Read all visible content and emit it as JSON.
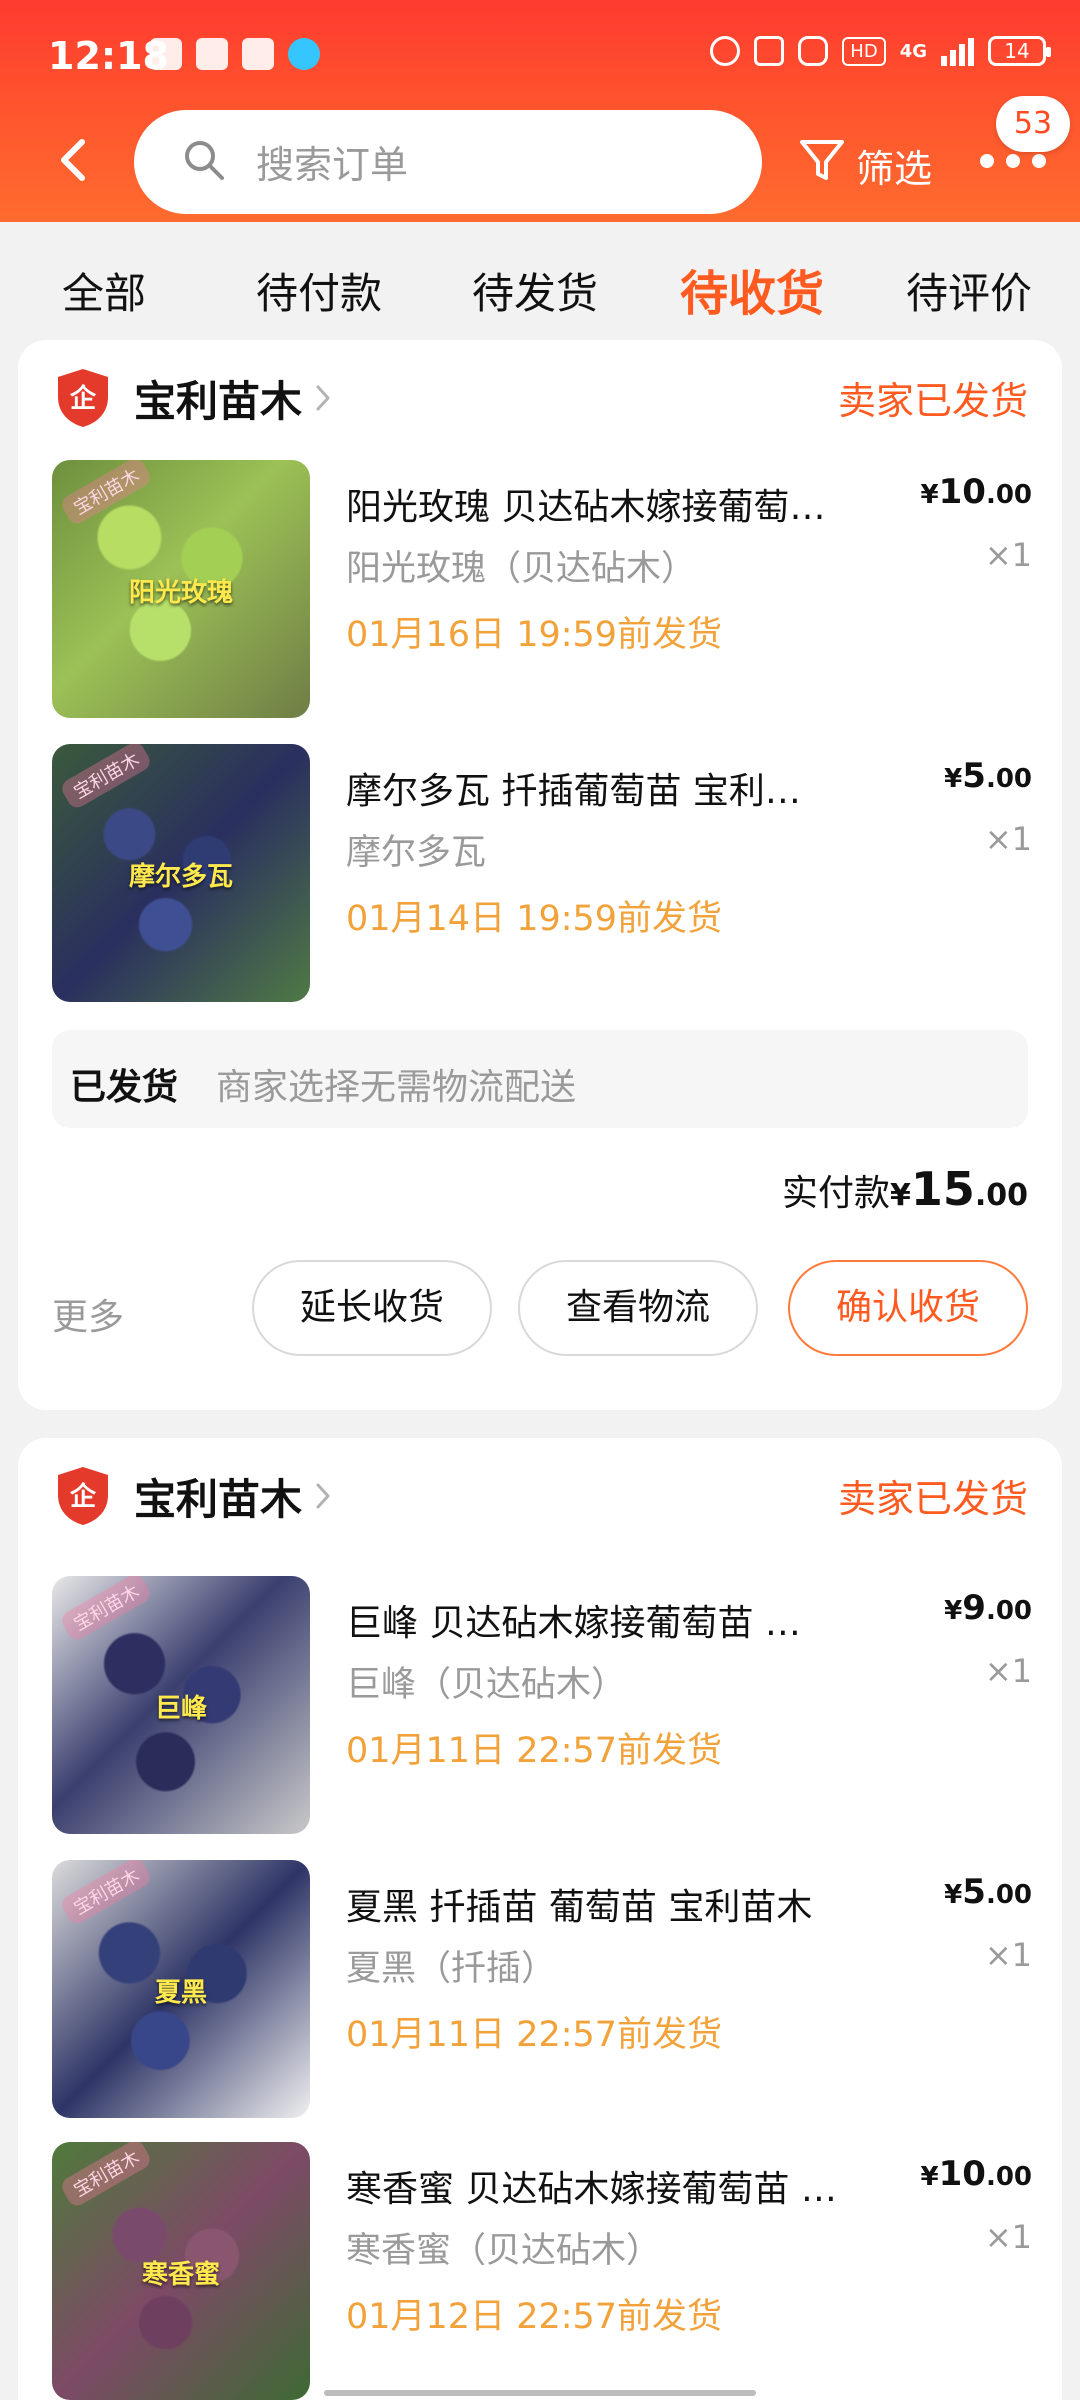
{
  "status_bar": {
    "time": "12:18",
    "network": "4G",
    "battery": "14"
  },
  "topbar": {
    "search_placeholder": "搜索订单",
    "filter_label": "筛选",
    "message_badge": "53"
  },
  "tabs": [
    {
      "label": "全部",
      "active": false
    },
    {
      "label": "待付款",
      "active": false
    },
    {
      "label": "待发货",
      "active": false
    },
    {
      "label": "待收货",
      "active": true
    },
    {
      "label": "待评价",
      "active": false
    }
  ],
  "orders": [
    {
      "store_name": "宝利苗木",
      "status": "卖家已发货",
      "items": [
        {
          "title": "阳光玫瑰  贝达砧木嫁接葡萄…",
          "spec": "阳光玫瑰（贝达砧木）",
          "ship": "01月16日  19:59前发货",
          "price_symbol": "¥",
          "price_int": "10",
          "price_dec": ".00",
          "qty": "×1",
          "thumb_label": "阳光玫瑰",
          "thumb_tag": "宝利苗木"
        },
        {
          "title": "摩尔多瓦    扦插葡萄苗    宝利…",
          "spec": "摩尔多瓦",
          "ship": "01月14日  19:59前发货",
          "price_symbol": "¥",
          "price_int": "5",
          "price_dec": ".00",
          "qty": "×1",
          "thumb_label": "摩尔多瓦",
          "thumb_tag": "宝利苗木"
        }
      ],
      "shipping_status": "已发货",
      "shipping_text": "商家选择无需物流配送",
      "total_label": "实付款",
      "total_symbol": "¥",
      "total_int": "15",
      "total_dec": ".00",
      "more_label": "更多",
      "buttons": {
        "extend": "延长收货",
        "logistics": "查看物流",
        "confirm": "确认收货"
      }
    },
    {
      "store_name": "宝利苗木",
      "status": "卖家已发货",
      "items": [
        {
          "title": "巨峰       贝达砧木嫁接葡萄苗  …",
          "spec": "巨峰（贝达砧木）",
          "ship": "01月11日  22:57前发货",
          "price_symbol": "¥",
          "price_int": "9",
          "price_dec": ".00",
          "qty": "×1",
          "thumb_label": "巨峰",
          "thumb_tag": "宝利苗木"
        },
        {
          "title": "夏黑  扦插苗  葡萄苗    宝利苗木",
          "spec": "夏黑（扦插）",
          "ship": "01月11日  22:57前发货",
          "price_symbol": "¥",
          "price_int": "5",
          "price_dec": ".00",
          "qty": "×1",
          "thumb_label": "夏黑",
          "thumb_tag": "宝利苗木"
        },
        {
          "title": "寒香蜜  贝达砧木嫁接葡萄苗  …",
          "spec": "寒香蜜（贝达砧木）",
          "ship": "01月12日  22:57前发货",
          "price_symbol": "¥",
          "price_int": "10",
          "price_dec": ".00",
          "qty": "×1",
          "thumb_label": "寒香蜜",
          "thumb_tag": "宝利苗木"
        }
      ]
    }
  ],
  "colors": {
    "accent": "#ff5a1f",
    "ship_text": "#f2a23a",
    "header_red": "#ff3b2f"
  }
}
